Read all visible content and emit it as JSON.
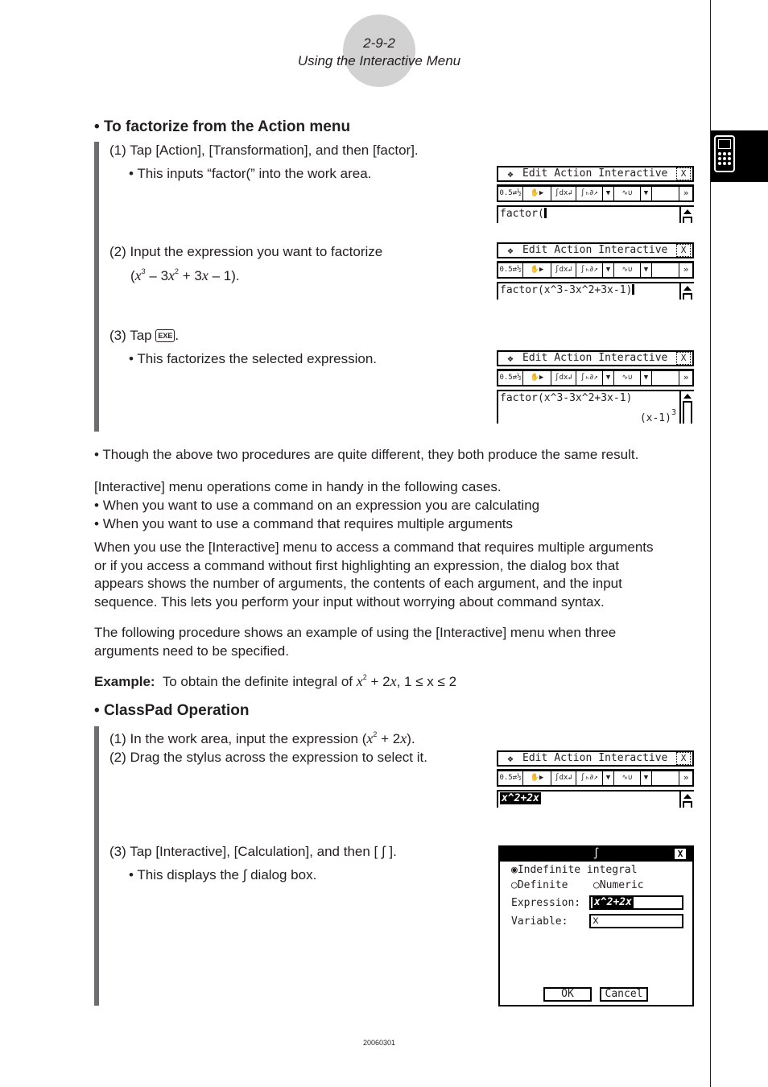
{
  "header": {
    "page_number": "2-9-2",
    "title": "Using the Interactive Menu"
  },
  "section1": {
    "heading": "To factorize from the Action menu",
    "steps": [
      {
        "num": "(1)",
        "text": "Tap [Action], [Transformation], and then [factor].",
        "bullet": "This inputs “factor(” into the work area."
      },
      {
        "num": "(2)",
        "text": "Input the expression you want to factorize",
        "expr_prefix": "(",
        "expr_suffix": ")."
      },
      {
        "num": "(3)",
        "text_before": "Tap",
        "key": "EXE",
        "text_after": ".",
        "bullet": "This factorizes the selected expression."
      }
    ]
  },
  "calc_menu": {
    "dropdown_icon": "❖",
    "items": [
      "Edit",
      "Action",
      "Interactive"
    ],
    "close": "X"
  },
  "calc_toolbar": {
    "buttons": [
      "0.5⇄½",
      "✋▶",
      "∫dx↲",
      "∫ₕ∂↗",
      "▼",
      "∿∪",
      "▼"
    ],
    "more": "»"
  },
  "screens": {
    "s1": {
      "line1": "factor("
    },
    "s2": {
      "line1": "factor(x^3-3x^2+3x-1)"
    },
    "s3": {
      "line1": "factor(x^3-3x^2+3x-1)",
      "result": "(x-1)",
      "result_exp": "3"
    },
    "s4": {
      "selected": "x^2+2x"
    }
  },
  "note": "Though the above two procedures are quite different, they both produce the same result.",
  "para1": {
    "intro": "[Interactive] menu operations come in handy in the following cases.",
    "bullets": [
      "When you want to use a command on an expression you are calculating",
      "When you want to use a command that requires multiple arguments"
    ]
  },
  "para2": [
    "When you use the [Interactive] menu to access a command that requires multiple arguments",
    "or if you access a command without first highlighting an expression, the dialog box that",
    "appears shows the number of arguments, the contents of each argument, and the input",
    "sequence. This lets you perform your input without worrying about command syntax."
  ],
  "para3": [
    "The following procedure shows an example of using the [Interactive] menu when three",
    "arguments need to be specified."
  ],
  "example": {
    "label": "Example:",
    "text": "To obtain the definite integral of",
    "range": ", 1 ≤ x ≤ 2"
  },
  "section2": {
    "heading": "ClassPad Operation",
    "steps": [
      {
        "num": "(1)",
        "text": "In the work area, input the expression ("
      },
      {
        "num": "(2)",
        "text": "Drag the stylus across the expression to select it."
      },
      {
        "num": "(3)",
        "text": "Tap [Interactive], [Calculation], and then [ ∫ ].",
        "bullet": "This displays the ∫ dialog box."
      }
    ]
  },
  "dialog": {
    "title": "∫",
    "close": "X",
    "radio_indefinite": "Indefinite integral",
    "radio_definite": "Definite",
    "radio_numeric": "Numeric",
    "selected_option": "Indefinite integral",
    "expression_label": "Expression:",
    "expression_value": "x^2+2x",
    "variable_label": "Variable:",
    "variable_value": "x",
    "ok": "OK",
    "cancel": "Cancel"
  },
  "footer": {
    "code": "20060301"
  }
}
